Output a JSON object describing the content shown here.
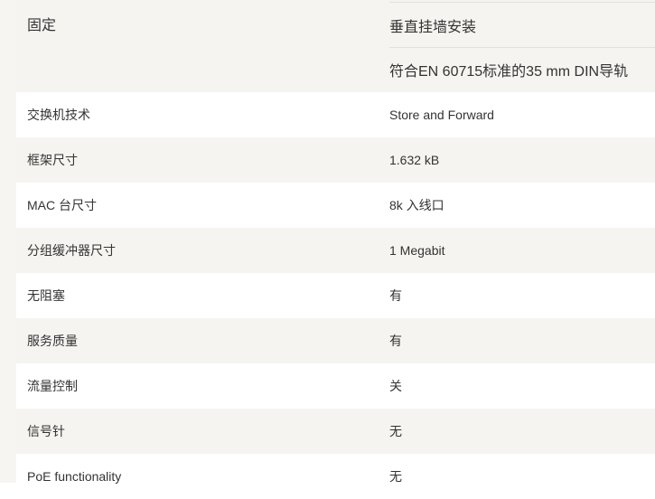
{
  "specs": [
    {
      "label": "固定",
      "values": [
        "垂直挂墙安装",
        "符合EN 60715标准的35 mm DIN导轨"
      ]
    },
    {
      "label": "交换机技术",
      "values": [
        "Store and Forward"
      ]
    },
    {
      "label": "框架尺寸",
      "values": [
        "1.632 kB"
      ]
    },
    {
      "label": "MAC 台尺寸",
      "values": [
        "8k 入线口"
      ]
    },
    {
      "label": "分组缓冲器尺寸",
      "values": [
        "1 Megabit"
      ]
    },
    {
      "label": "无阻塞",
      "values": [
        "有"
      ]
    },
    {
      "label": "服务质量",
      "values": [
        "有"
      ]
    },
    {
      "label": "流量控制",
      "values": [
        "关"
      ]
    },
    {
      "label": "信号针",
      "values": [
        "无"
      ]
    },
    {
      "label": "PoE functionality",
      "values": [
        "无"
      ]
    }
  ]
}
